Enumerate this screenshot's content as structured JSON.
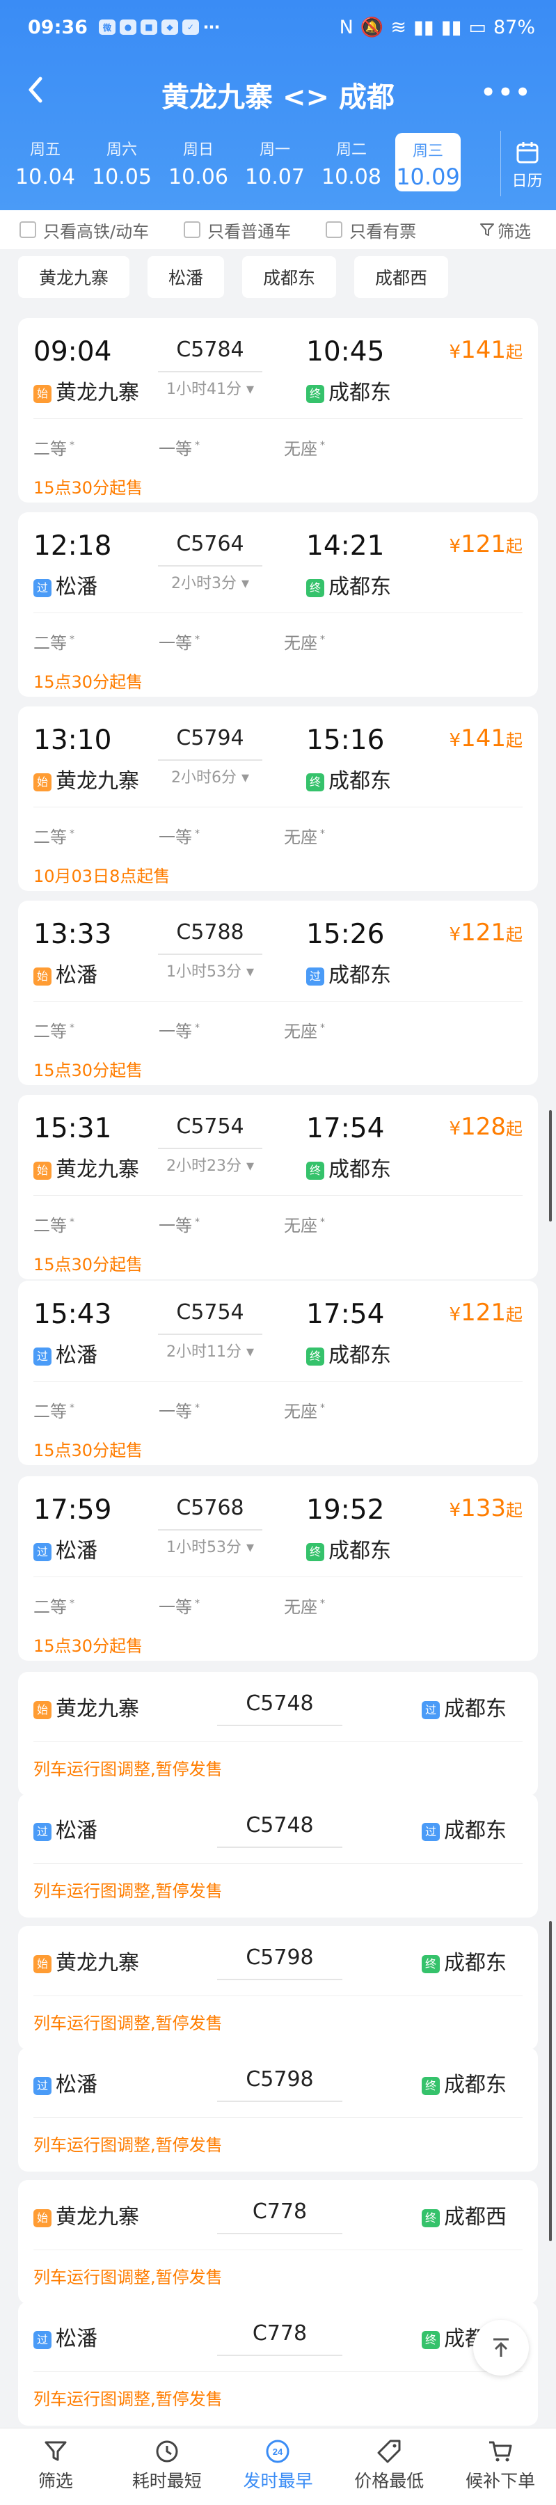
{
  "status": {
    "time": "09:36",
    "battery": "87%"
  },
  "nav": {
    "title": "黄龙九寨 <> 成都",
    "calendar_label": "日历"
  },
  "dates": [
    {
      "weekday": "周五",
      "date": "10.04"
    },
    {
      "weekday": "周六",
      "date": "10.05"
    },
    {
      "weekday": "周日",
      "date": "10.06"
    },
    {
      "weekday": "周一",
      "date": "10.07"
    },
    {
      "weekday": "周二",
      "date": "10.08"
    },
    {
      "weekday": "周三",
      "date": "10.09",
      "selected": true
    }
  ],
  "filters": {
    "high_speed": "只看高铁/动车",
    "normal": "只看普通车",
    "available": "只看有票",
    "screen": "筛选"
  },
  "stations": [
    "黄龙九寨",
    "松潘",
    "成都东",
    "成都西"
  ],
  "trains": [
    {
      "dep_time": "09:04",
      "number": "C5784",
      "duration": "1小时41分",
      "arr_time": "10:45",
      "dep_tag": "始",
      "dep_station": "黄龙九寨",
      "arr_tag": "终",
      "arr_station": "成都东",
      "price": "141",
      "price_suffix": "起",
      "seats": [
        "二等",
        "一等",
        "无座"
      ],
      "sale": "15点30分起售"
    },
    {
      "dep_time": "12:18",
      "number": "C5764",
      "duration": "2小时3分",
      "arr_time": "14:21",
      "dep_tag": "过",
      "dep_station": "松潘",
      "arr_tag": "终",
      "arr_station": "成都东",
      "price": "121",
      "price_suffix": "起",
      "seats": [
        "二等",
        "一等",
        "无座"
      ],
      "sale": "15点30分起售"
    },
    {
      "dep_time": "13:10",
      "number": "C5794",
      "duration": "2小时6分",
      "arr_time": "15:16",
      "dep_tag": "始",
      "dep_station": "黄龙九寨",
      "arr_tag": "终",
      "arr_station": "成都东",
      "price": "141",
      "price_suffix": "起",
      "seats": [
        "二等",
        "一等",
        "无座"
      ],
      "sale": "10月03日8点起售"
    },
    {
      "dep_time": "13:33",
      "number": "C5788",
      "duration": "1小时53分",
      "arr_time": "15:26",
      "dep_tag": "始",
      "dep_station": "松潘",
      "arr_tag": "过",
      "arr_station": "成都东",
      "price": "121",
      "price_suffix": "起",
      "seats": [
        "二等",
        "一等",
        "无座"
      ],
      "sale": "15点30分起售"
    },
    {
      "dep_time": "15:31",
      "number": "C5754",
      "duration": "2小时23分",
      "arr_time": "17:54",
      "dep_tag": "始",
      "dep_station": "黄龙九寨",
      "arr_tag": "终",
      "arr_station": "成都东",
      "price": "128",
      "price_suffix": "起",
      "seats": [
        "二等",
        "一等",
        "无座"
      ],
      "sale": "15点30分起售"
    },
    {
      "dep_time": "15:43",
      "number": "C5754",
      "duration": "2小时11分",
      "arr_time": "17:54",
      "dep_tag": "过",
      "dep_station": "松潘",
      "arr_tag": "终",
      "arr_station": "成都东",
      "price": "121",
      "price_suffix": "起",
      "seats": [
        "二等",
        "一等",
        "无座"
      ],
      "sale": "15点30分起售"
    },
    {
      "dep_time": "17:59",
      "number": "C5768",
      "duration": "1小时53分",
      "arr_time": "19:52",
      "dep_tag": "过",
      "dep_station": "松潘",
      "arr_tag": "终",
      "arr_station": "成都东",
      "price": "133",
      "price_suffix": "起",
      "seats": [
        "二等",
        "一等",
        "无座"
      ],
      "sale": "15点30分起售"
    }
  ],
  "suspended": [
    {
      "dep_tag": "始",
      "dep_station": "黄龙九寨",
      "number": "C5748",
      "arr_tag": "过",
      "arr_station": "成都东",
      "message": "列车运行图调整,暂停发售"
    },
    {
      "dep_tag": "过",
      "dep_station": "松潘",
      "number": "C5748",
      "arr_tag": "过",
      "arr_station": "成都东",
      "message": "列车运行图调整,暂停发售"
    },
    {
      "dep_tag": "始",
      "dep_station": "黄龙九寨",
      "number": "C5798",
      "arr_tag": "终",
      "arr_station": "成都东",
      "message": "列车运行图调整,暂停发售"
    },
    {
      "dep_tag": "过",
      "dep_station": "松潘",
      "number": "C5798",
      "arr_tag": "终",
      "arr_station": "成都东",
      "message": "列车运行图调整,暂停发售"
    },
    {
      "dep_tag": "始",
      "dep_station": "黄龙九寨",
      "number": "C778",
      "arr_tag": "终",
      "arr_station": "成都西",
      "message": "列车运行图调整,暂停发售"
    },
    {
      "dep_tag": "过",
      "dep_station": "松潘",
      "number": "C778",
      "arr_tag": "终",
      "arr_station": "成都西",
      "message": "列车运行图调整,暂停发售"
    }
  ],
  "bottom_tabs": [
    {
      "label": "筛选",
      "icon": "filter-icon"
    },
    {
      "label": "耗时最短",
      "icon": "clock-icon"
    },
    {
      "label": "发时最早",
      "icon": "24h-icon",
      "selected": true
    },
    {
      "label": "价格最低",
      "icon": "price-tag-icon"
    },
    {
      "label": "候补下单",
      "icon": "cart-icon"
    }
  ],
  "colors": {
    "primary": "#3a8cf5",
    "price": "#ff7d00",
    "tag_start": "#ff9c33",
    "tag_pass": "#4a9bf7",
    "tag_end": "#35c26b"
  }
}
